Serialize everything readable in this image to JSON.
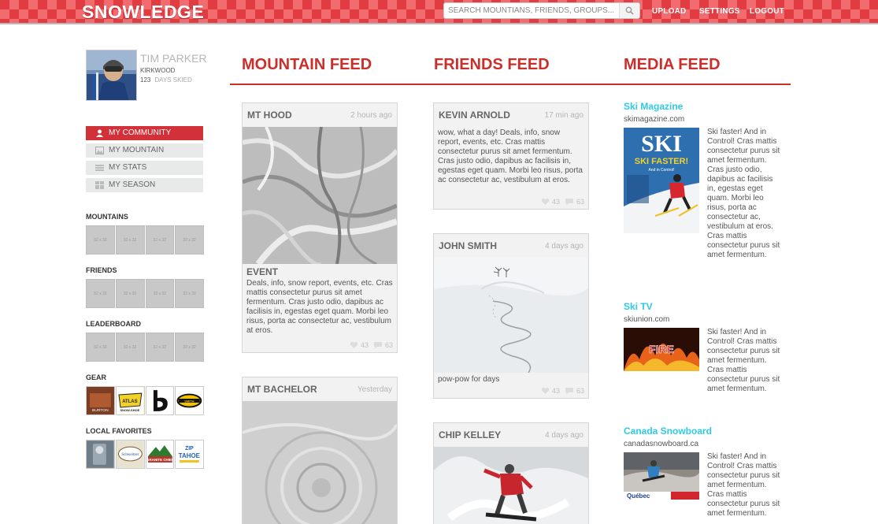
{
  "brand": "SNOWLEDGE",
  "search": {
    "placeholder": "SEARCH MOUNTIANS, FRIENDS, GROUPS..."
  },
  "nav": {
    "upload": "UPLOAD",
    "settings": "SETTINGS",
    "logout": "LOGOUT"
  },
  "profile": {
    "name": "TIM PARKER",
    "home": "KIRKWOOD",
    "days": "123",
    "days_label": "DAYS SKIED"
  },
  "menu": [
    {
      "label": "MY COMMUNITY",
      "icon": "user-icon"
    },
    {
      "label": "MY MOUNTAIN",
      "icon": "mountain-icon"
    },
    {
      "label": "MY STATS",
      "icon": "stats-icon"
    },
    {
      "label": "MY SEASON",
      "icon": "calendar-icon"
    }
  ],
  "sidebar": {
    "mountains": "MOUNTAINS",
    "friends": "FRIENDS",
    "leaderboard": "LEADERBOARD",
    "gear": "GEAR",
    "local": "LOCAL FAVORITES",
    "placeholder": "32 x 32",
    "gear_logos": [
      "BURTON",
      "ATLAS SNOW-SHOE",
      "B",
      "SMITH"
    ],
    "local_logos": [
      "",
      "Schweitzer",
      "GRANITE CHIEF",
      "ZIP TAHOE"
    ]
  },
  "feeds": {
    "mountain": "MOUNTAIN FEED",
    "friends": "FRIENDS FEED",
    "media": "MEDIA FEED"
  },
  "mountain_cards": [
    {
      "title": "MT HOOD",
      "time": "2 hours ago",
      "subtitle": "EVENT",
      "body": "Deals, info, snow report, events, etc. Cras mattis consectetur purus sit amet fermentum. Cras justo odio, dapibus ac facilisis in, egestas eget quam. Morbi leo risus, porta ac consectetur ac, vestibulum at eros.",
      "likes": "43",
      "comments": "63"
    },
    {
      "title": "MT BACHELOR",
      "time": "Yesterday"
    }
  ],
  "friend_cards": [
    {
      "title": "KEVIN ARNOLD",
      "time": "17 min ago",
      "body": "wow, what a day! Deals, info, snow report, events, etc. Cras mattis consectetur purus sit amet fermentum. Cras justo odio, dapibus ac facilisis in, egestas eget quam. Morbi leo risus, porta ac consectetur ac, vestibulum at eros.",
      "likes": "43",
      "comments": "63"
    },
    {
      "title": "JOHN SMITH",
      "time": "4 days ago",
      "body": "pow-pow for days",
      "likes": "43",
      "comments": "63"
    },
    {
      "title": "CHIP KELLEY",
      "time": "4 days ago"
    }
  ],
  "media": [
    {
      "title": "Ski Magazine",
      "url": "skimagazine.com",
      "cover_title": "SKI",
      "cover_headline": "SKI FASTER!",
      "cover_sub": "And in Control!",
      "text": "Ski faster! And in Control! Cras mattis consectetur purus sit amet fermentum. Cras justo odio, dapibus ac facilisis in, egestas eget quam. Morbi leo risus, porta ac consectetur ac, vestibulum at eros. Cras mattis consectetur purus sit amet fermentum."
    },
    {
      "title": "Ski TV",
      "url": "skiunion.com",
      "image_label": "FIRE",
      "text": "Ski faster! And in Control! Cras mattis consectetur purus sit amet fermentum. Cras mattis consectetur purus sit amet fermentum."
    },
    {
      "title": "Canada Snowboard",
      "url": "canadasnowboard.ca",
      "image_label": "Québec",
      "text": "Ski faster! And in Control! Cras mattis consectetur purus sit amet fermentum. Cras mattis consectetur purus sit amet fermentum."
    }
  ],
  "colors": {
    "brand_red": "#d3313a",
    "heading_red": "#c9302c",
    "media_link": "#2fcae6"
  }
}
